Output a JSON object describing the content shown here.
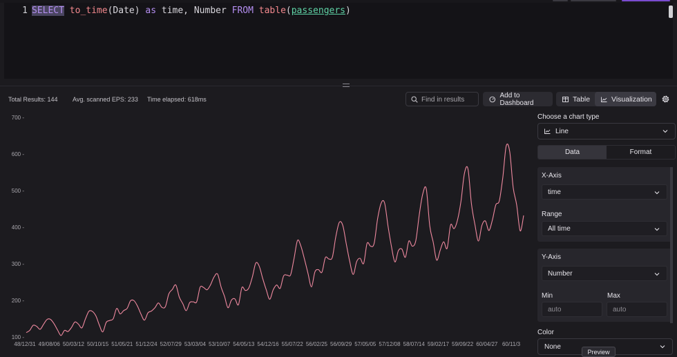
{
  "editor": {
    "line_number": "1",
    "tokens": [
      {
        "text": "SELECT",
        "cls": "tk-kw hl"
      },
      {
        "text": " ",
        "cls": "tk-id"
      },
      {
        "text": "to_time",
        "cls": "tk-fn"
      },
      {
        "text": "(Date) ",
        "cls": "tk-id"
      },
      {
        "text": "as",
        "cls": "tk-kw"
      },
      {
        "text": " time, Number ",
        "cls": "tk-id"
      },
      {
        "text": "FROM",
        "cls": "tk-kw"
      },
      {
        "text": " ",
        "cls": "tk-id"
      },
      {
        "text": "table",
        "cls": "tk-fn"
      },
      {
        "text": "(",
        "cls": "tk-id"
      },
      {
        "text": "passengers",
        "cls": "tk-tbl"
      },
      {
        "text": ")",
        "cls": "tk-id"
      }
    ]
  },
  "stats": {
    "total": "Total Results: 144",
    "eps": "Avg. scanned EPS: 233",
    "elapsed": "Time elapsed: 618ms"
  },
  "toolbar": {
    "search_placeholder": "Find in results",
    "add_dashboard": "Add to Dashboard",
    "table_label": "Table",
    "visualization_label": "Visualization"
  },
  "panel": {
    "chart_type_label": "Choose a chart type",
    "chart_type_value": "Line",
    "tab_data": "Data",
    "tab_format": "Format",
    "xaxis_label": "X-Axis",
    "xaxis_value": "time",
    "range_label": "Range",
    "range_value": "All time",
    "yaxis_label": "Y-Axis",
    "yaxis_value": "Number",
    "min_label": "Min",
    "max_label": "Max",
    "min_placeholder": "auto",
    "max_placeholder": "auto",
    "color_label": "Color",
    "color_value": "None",
    "preview_label": "Preview"
  },
  "colors": {
    "line": "#f08aa0",
    "accent": "#7a4bd0"
  },
  "chart_data": {
    "type": "line",
    "ylim": [
      100,
      700
    ],
    "yticks": [
      100,
      200,
      300,
      400,
      500,
      600,
      700
    ],
    "xtick_labels": [
      "48/12/31",
      "49/08/06",
      "50/03/12",
      "50/10/15",
      "51/05/21",
      "51/12/24",
      "52/07/29",
      "53/03/04",
      "53/10/07",
      "54/05/13",
      "54/12/16",
      "55/07/22",
      "56/02/25",
      "56/09/29",
      "57/05/05",
      "57/12/08",
      "58/07/14",
      "59/02/17",
      "59/09/22",
      "60/04/27",
      "60/11/3"
    ],
    "series": [
      {
        "values": [
          112,
          118,
          132,
          129,
          121,
          135,
          148,
          148,
          136,
          119,
          104,
          118,
          115,
          126,
          141,
          135,
          125,
          149,
          170,
          170,
          158,
          133,
          114,
          140,
          145,
          150,
          178,
          163,
          172,
          178,
          199,
          199,
          184,
          162,
          146,
          166,
          171,
          180,
          193,
          181,
          183,
          218,
          230,
          242,
          209,
          191,
          172,
          194,
          196,
          196,
          236,
          235,
          229,
          243,
          264,
          272,
          237,
          211,
          180,
          201,
          204,
          188,
          235,
          227,
          234,
          264,
          302,
          293,
          259,
          229,
          203,
          229,
          242,
          233,
          267,
          269,
          270,
          315,
          364,
          347,
          312,
          274,
          237,
          278,
          284,
          277,
          317,
          313,
          318,
          374,
          413,
          405,
          355,
          306,
          271,
          306,
          315,
          301,
          356,
          348,
          355,
          422,
          465,
          467,
          404,
          347,
          305,
          336,
          340,
          318,
          362,
          348,
          363,
          435,
          491,
          505,
          404,
          359,
          310,
          337,
          360,
          342,
          406,
          396,
          420,
          472,
          548,
          559,
          463,
          407,
          362,
          405,
          417,
          391,
          419,
          461,
          472,
          535,
          622,
          606,
          508,
          461,
          390,
          432
        ]
      }
    ]
  }
}
